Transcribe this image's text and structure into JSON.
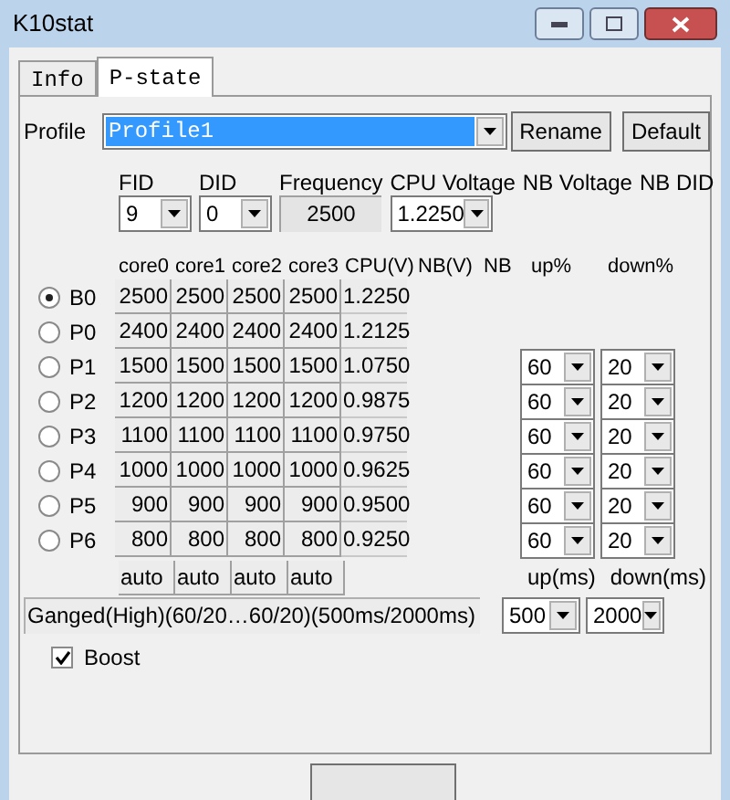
{
  "window": {
    "title": "K10stat"
  },
  "tabs": [
    {
      "label": "Info",
      "selected": false
    },
    {
      "label": "P-state",
      "selected": true
    }
  ],
  "profile": {
    "label": "Profile",
    "value": "Profile1",
    "buttons": [
      "Rename",
      "Default"
    ]
  },
  "fields": [
    {
      "label": "FID",
      "value": "9",
      "kind": "combo"
    },
    {
      "label": "DID",
      "value": "0",
      "kind": "combo"
    },
    {
      "label": "Frequency",
      "value": "2500",
      "kind": "readout"
    },
    {
      "label": "CPU Voltage",
      "value": "1.2250",
      "kind": "combo"
    },
    {
      "label": "NB Voltage",
      "kind": "label"
    },
    {
      "label": "NB DID",
      "kind": "label"
    }
  ],
  "table": {
    "columns": [
      "core0",
      "core1",
      "core2",
      "core3",
      "CPU(V)",
      "NB(V)",
      "NB",
      "up%",
      "down%"
    ],
    "rows": [
      {
        "label": "B0",
        "selected": true,
        "cores": [
          "2500",
          "2500",
          "2500",
          "2500"
        ],
        "cpu_v": "1.2250"
      },
      {
        "label": "P0",
        "selected": false,
        "cores": [
          "2400",
          "2400",
          "2400",
          "2400"
        ],
        "cpu_v": "1.2125"
      },
      {
        "label": "P1",
        "selected": false,
        "cores": [
          "1500",
          "1500",
          "1500",
          "1500"
        ],
        "cpu_v": "1.0750",
        "up": "60",
        "down": "20"
      },
      {
        "label": "P2",
        "selected": false,
        "cores": [
          "1200",
          "1200",
          "1200",
          "1200"
        ],
        "cpu_v": "0.9875",
        "up": "60",
        "down": "20"
      },
      {
        "label": "P3",
        "selected": false,
        "cores": [
          "1100",
          "1100",
          "1100",
          "1100"
        ],
        "cpu_v": "0.9750",
        "up": "60",
        "down": "20"
      },
      {
        "label": "P4",
        "selected": false,
        "cores": [
          "1000",
          "1000",
          "1000",
          "1000"
        ],
        "cpu_v": "0.9625",
        "up": "60",
        "down": "20"
      },
      {
        "label": "P5",
        "selected": false,
        "cores": [
          "900",
          "900",
          "900",
          "900"
        ],
        "cpu_v": "0.9500",
        "up": "60",
        "down": "20"
      },
      {
        "label": "P6",
        "selected": false,
        "cores": [
          "800",
          "800",
          "800",
          "800"
        ],
        "cpu_v": "0.9250",
        "up": "60",
        "down": "20"
      }
    ],
    "auto_buttons": [
      "auto",
      "auto",
      "auto",
      "auto"
    ],
    "timing_labels": [
      "up(ms)",
      "down(ms)"
    ]
  },
  "mode": {
    "text": "Ganged(High)(60/20…60/20)(500ms/2000ms)",
    "up_ms": "500",
    "down_ms": "2000"
  },
  "boost": {
    "label": "Boost",
    "checked": true
  }
}
